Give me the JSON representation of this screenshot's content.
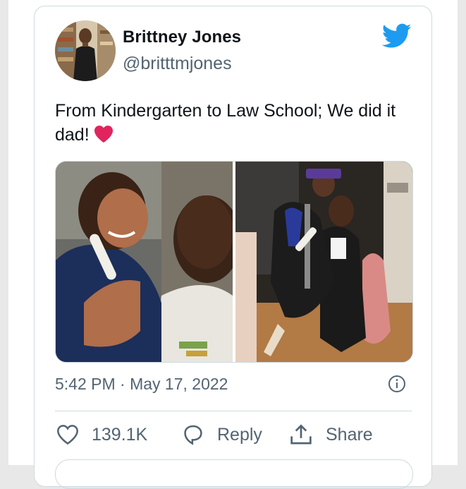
{
  "author": {
    "name": "Brittney Jones",
    "handle": "@britttmjones",
    "avatar_icon": "profile-photo"
  },
  "brand_icon": "twitter-bird-icon",
  "brand_color": "#1d9bf0",
  "tweet": {
    "text": "From Kindergarten to Law School; We did it dad!",
    "emoji": "red-heart",
    "emoji_color": "#e0245e"
  },
  "media": {
    "count": 2,
    "photos": [
      "childhood-photo-with-father",
      "law-school-graduation-photo-with-father"
    ]
  },
  "meta": {
    "timestamp": "5:42 PM · May 17, 2022"
  },
  "actions": {
    "like_count": "139.1K",
    "reply_label": "Reply",
    "share_label": "Share"
  }
}
